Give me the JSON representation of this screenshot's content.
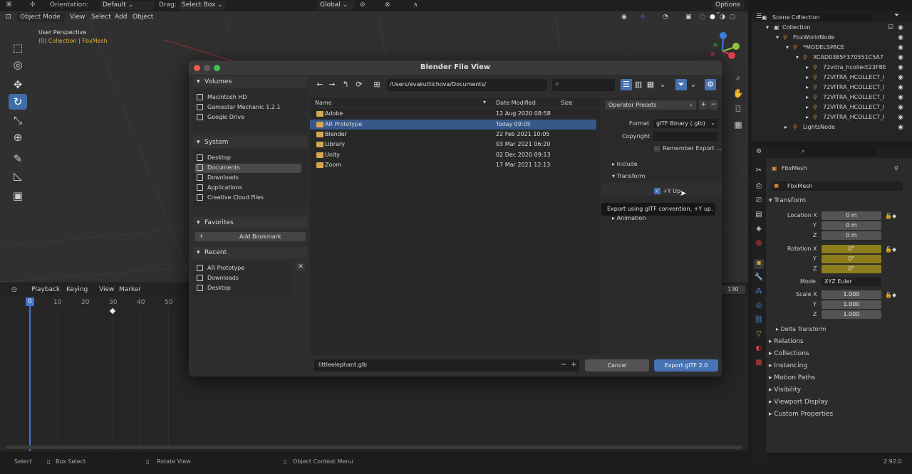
{
  "topbar": {
    "orientation_label": "Orientation:",
    "orientation_value": "Default",
    "drag_label": "Drag:",
    "drag_value": "Select Box",
    "transform_orientation": "Global",
    "options_label": "Options"
  },
  "view_header": {
    "mode": "Object Mode",
    "menus": [
      "View",
      "Select",
      "Add",
      "Object"
    ]
  },
  "viewport": {
    "view_name": "User Perspective",
    "collection_info": "(0) Collection | FbxMesh"
  },
  "timeline": {
    "menus": [
      "Playback",
      "Keying",
      "View",
      "Marker"
    ],
    "ticks": [
      "10",
      "20",
      "30",
      "40",
      "50"
    ],
    "current_frame": "0",
    "end_frame": "130"
  },
  "statusbar": {
    "items": [
      "Select",
      "Box Select",
      "Rotate View",
      "Object Context Menu"
    ],
    "version": "2.92.0"
  },
  "outliner": {
    "rows": [
      {
        "label": "Scene Collection",
        "indent": 0
      },
      {
        "label": "Collection",
        "indent": 1
      },
      {
        "label": "FbxWorldNode",
        "indent": 2
      },
      {
        "label": "*MODELSPACE",
        "indent": 3
      },
      {
        "label": "XCAD0385F370551C5A7",
        "indent": 4
      },
      {
        "label": "72vitra_hcollect23F8E",
        "indent": 5
      },
      {
        "label": "72VITRA_HCOLLECT_I",
        "indent": 5
      },
      {
        "label": "72VITRA_HCOLLECT_I",
        "indent": 5
      },
      {
        "label": "72VITRA_HCOLLECT_I",
        "indent": 5
      },
      {
        "label": "72VITRA_HCOLLECT_I",
        "indent": 5
      },
      {
        "label": "72VITRA_HCOLLECT_I",
        "indent": 5
      },
      {
        "label": "LightsNode",
        "indent": 2
      }
    ]
  },
  "properties": {
    "object_name": "FbxMesh",
    "object_data_name": "FbxMesh",
    "transform_label": "Transform",
    "location_label": "Location X",
    "location": [
      "0 m",
      "0 m",
      "0 m"
    ],
    "rotation_label": "Rotation X",
    "rotation": [
      "0°",
      "0°",
      "0°"
    ],
    "mode_label": "Mode",
    "mode_value": "XYZ Euler",
    "scale_label": "Scale X",
    "scale": [
      "1.000",
      "1.000",
      "1.000"
    ],
    "axis_y": "Y",
    "axis_z": "Z",
    "delta_transform": "Delta Transform",
    "sections": [
      "Relations",
      "Collections",
      "Instancing",
      "Motion Paths",
      "Visibility",
      "Viewport Display",
      "Custom Properties"
    ]
  },
  "dialog": {
    "title": "Blender File View",
    "volumes_header": "Volumes",
    "volumes": [
      "Macintosh HD",
      "Gamestar Mechanic 1.2.1",
      "Google Drive"
    ],
    "system_header": "System",
    "system": [
      "Desktop",
      "Documents",
      "Downloads",
      "Applications",
      "Creative Cloud Files"
    ],
    "favorites_header": "Favorites",
    "add_bookmark": "Add Bookmark",
    "recent_header": "Recent",
    "recent": [
      "AR Prototype",
      "Downloads",
      "Desktop"
    ],
    "path": "/Users/evakuttichova/Documents/",
    "columns": {
      "name": "Name",
      "date": "Date Modified",
      "size": "Size"
    },
    "files": [
      {
        "name": "Adobe",
        "date": "12 Aug 2020 08:58"
      },
      {
        "name": "AR Prototype",
        "date": "Today 09:05"
      },
      {
        "name": "Blender",
        "date": "22 Feb 2021 10:05"
      },
      {
        "name": "Library",
        "date": "03 Mar 2021 06:20"
      },
      {
        "name": "Unity",
        "date": "02 Dec 2020 09:13"
      },
      {
        "name": "Zoom",
        "date": "17 Mar 2021 12:13"
      }
    ],
    "operator_presets": "Operator Presets",
    "format_label": "Format",
    "format_value": "glTF Binary (.glb)",
    "copyright_label": "Copyright",
    "remember_export": "Remember Export ...",
    "include": "Include",
    "transform": "Transform",
    "y_up": "+Y Up",
    "tooltip": "Export using glTF convention, +Y up.",
    "animation": "Animation",
    "filename": "littleelephant.glb",
    "cancel": "Cancel",
    "export": "Export glTF 2.0"
  }
}
